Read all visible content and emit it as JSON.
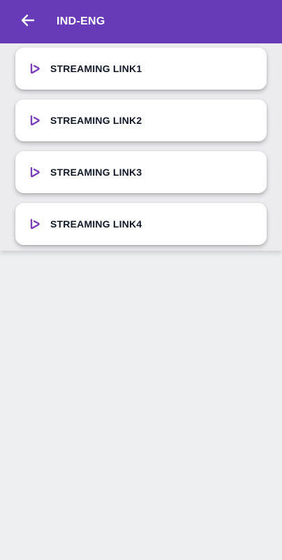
{
  "header": {
    "title": "IND-ENG",
    "back_icon": "arrow-left-icon",
    "background_color": "#673ab7"
  },
  "links": [
    {
      "label": "STREAMING LINK1",
      "icon": "play-icon"
    },
    {
      "label": "STREAMING LINK2",
      "icon": "play-icon"
    },
    {
      "label": "STREAMING LINK3",
      "icon": "play-icon"
    },
    {
      "label": "STREAMING LINK4",
      "icon": "play-icon"
    }
  ],
  "colors": {
    "accent": "#673ab7",
    "icon": "#7b3fb8",
    "page_background": "#eeeff1",
    "card_background": "#ffffff"
  }
}
